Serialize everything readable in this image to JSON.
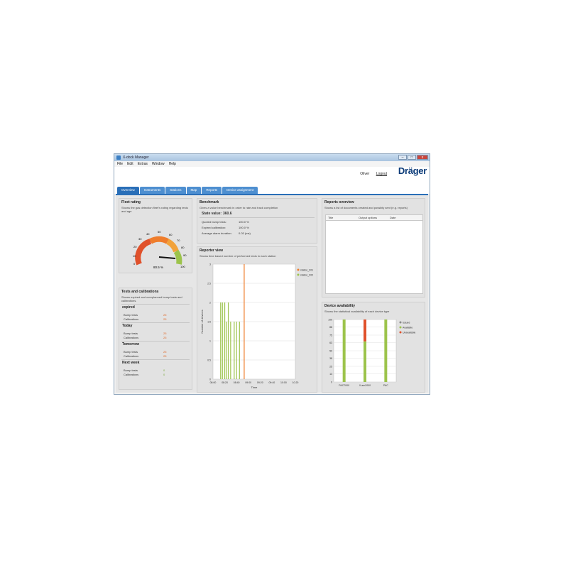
{
  "window": {
    "title": "X-dock Manager",
    "buttons": [
      "–",
      "□",
      "x"
    ]
  },
  "menu": [
    "File",
    "Edit",
    "Extras",
    "Window",
    "Help"
  ],
  "header": {
    "user": "Oliver",
    "logout": "Logout",
    "logo": "Dräger"
  },
  "tabs": [
    "Overview",
    "Instruments",
    "Stations",
    "Map",
    "Reports",
    "Device assignment"
  ],
  "fleet_rating": {
    "title": "Fleet rating",
    "desc": "Shows the gas detection fleet's rating regarding tests and age",
    "value_label": "80.5 %",
    "value": 80.5,
    "ticks": [
      "0",
      "10",
      "20",
      "30",
      "40",
      "50",
      "60",
      "70",
      "80",
      "90",
      "100"
    ]
  },
  "benchmark": {
    "title": "Benchmark",
    "desc": "Gives a value benchmark in order to rate and track completion",
    "state_label": "State value:",
    "state_value": "360.6",
    "rows": [
      {
        "label": "Quoted bump tests:",
        "value": "100.0 %"
      },
      {
        "label": "Expired calibration:",
        "value": "100.0 %"
      },
      {
        "label": "Average alarm duration:",
        "value": "0.03 (ms)"
      }
    ]
  },
  "reports": {
    "title": "Reports overview",
    "desc": "Shows a list of documents created and possibly sent (e.g. reports)",
    "columns": [
      "Title",
      "Output options",
      "Date"
    ]
  },
  "station_view": {
    "title": "Reporter view",
    "desc": "Shows time based number of performed tests in each station",
    "xlabel": "Time",
    "ylabel": "Number of devices",
    "x_ticks": [
      "08:00",
      "08:20",
      "08:40",
      "09:00",
      "09:20",
      "09:40",
      "10:00",
      "10:20"
    ],
    "y_ticks": [
      "0",
      "0.5",
      "1",
      "1.5",
      "2",
      "2.5",
      "3"
    ],
    "legend": [
      "station_001",
      "station_002"
    ]
  },
  "tests": {
    "title": "Tests and calibrations",
    "desc": "Shows expired and overplanned bump tests and calibrations.",
    "groups": [
      {
        "name": "expired",
        "bump": "25",
        "cal": "25"
      },
      {
        "name": "Today",
        "bump": "25",
        "cal": "25"
      },
      {
        "name": "Tomorrow",
        "bump": "25",
        "cal": "25"
      },
      {
        "name": "Next week",
        "bump": "0",
        "cal": "0"
      }
    ],
    "bump_label": "Bump tests",
    "cal_label": "Calibrations"
  },
  "device_availability": {
    "title": "Device availability",
    "desc": "Shows the statistical availability of each device type",
    "legend": [
      "Issued",
      "Available",
      "Unavailable"
    ]
  },
  "colors": {
    "orange": "#ef7d2c",
    "green": "#9cc34b",
    "blue": "#2a6fb8",
    "red": "#e0512b"
  },
  "chart_data": [
    {
      "type": "bar",
      "title": "Reporter view",
      "xlabel": "Time",
      "ylabel": "Number of devices",
      "ylim": [
        0,
        3
      ],
      "x_ticks": [
        "08:00",
        "08:20",
        "08:40",
        "09:00",
        "09:20",
        "09:40",
        "10:00",
        "10:20"
      ],
      "series": [
        {
          "name": "station_001",
          "x": [
            "08:53"
          ],
          "values": [
            3
          ]
        },
        {
          "name": "station_002",
          "x": [
            "08:13",
            "08:16",
            "08:20",
            "08:23",
            "08:26",
            "08:30",
            "08:36",
            "08:40",
            "08:45"
          ],
          "values": [
            2,
            2,
            2,
            1.5,
            2,
            1.5,
            1.5,
            1.5,
            1.5
          ]
        }
      ],
      "legend": "top-right"
    },
    {
      "type": "bar",
      "title": "Device availability",
      "categories": [
        "PAC7000",
        "X-am2000",
        "PAC"
      ],
      "ylim": [
        0,
        100
      ],
      "y_ticks": [
        "0",
        "13",
        "25",
        "38",
        "50",
        "63",
        "75",
        "88",
        "100"
      ],
      "series": [
        {
          "name": "Available",
          "values": [
            100,
            65,
            100
          ]
        },
        {
          "name": "Unavailable",
          "values": [
            0,
            35,
            0
          ]
        }
      ],
      "legend": "top-right"
    }
  ]
}
